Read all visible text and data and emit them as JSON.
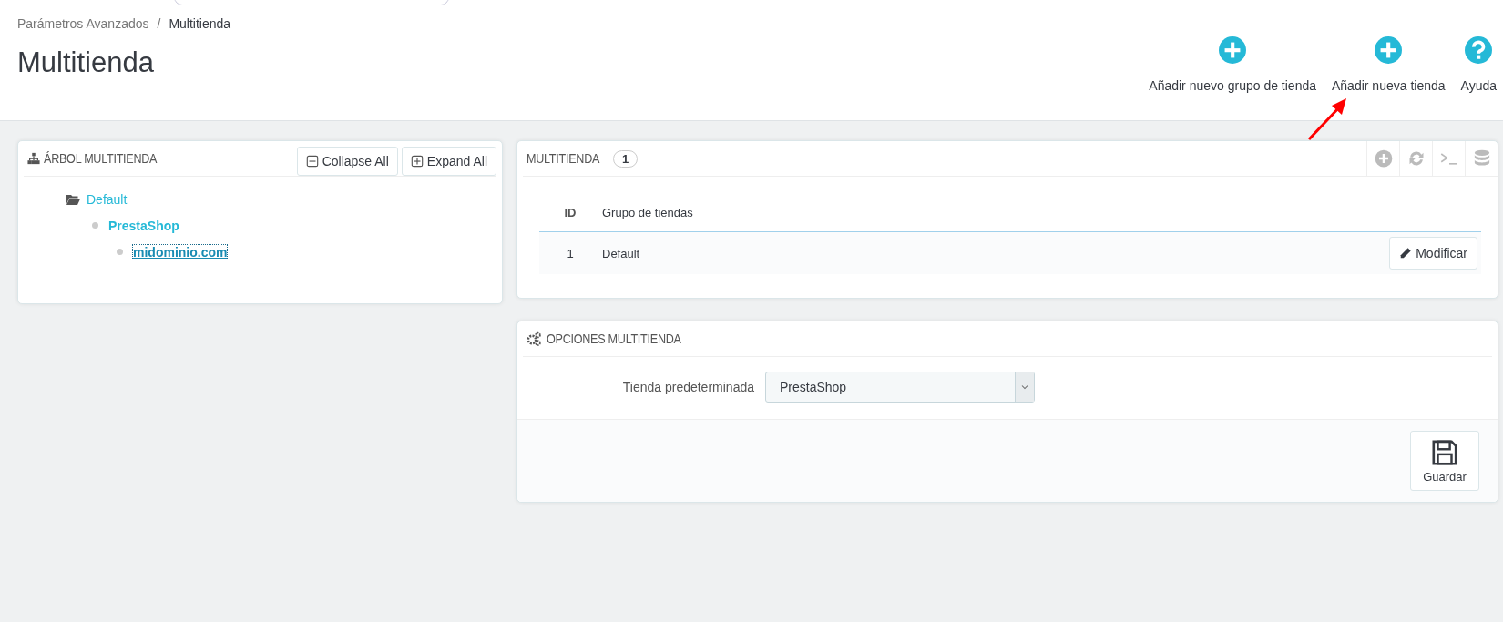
{
  "breadcrumb": [
    {
      "label": "Parámetros Avanzados",
      "current": false
    },
    {
      "label": "Multitienda",
      "current": true
    }
  ],
  "breadcrumb_separator": "/",
  "page_title": "Multitienda",
  "toolbar": [
    {
      "label": "Añadir nuevo grupo de tienda",
      "kind": "add"
    },
    {
      "label": "Añadir nueva tienda",
      "kind": "add"
    },
    {
      "label": "Ayuda",
      "kind": "help"
    }
  ],
  "tree_panel": {
    "title": "ÁRBOL MULTITIENDA",
    "buttons": [
      {
        "label": "Collapse All",
        "kind": "collapse"
      },
      {
        "label": "Expand All",
        "kind": "expand"
      }
    ],
    "tree": [
      {
        "label": "Default",
        "kind": "group",
        "focused": false,
        "children": [
          {
            "label": "PrestaShop",
            "kind": "shop",
            "focused": false,
            "children": [
              {
                "label": "midominio.com",
                "kind": "url",
                "focused": true
              }
            ]
          }
        ]
      }
    ]
  },
  "list_panel": {
    "title": "MULTITIENDA",
    "count": "1",
    "table": {
      "columns": [
        "ID",
        "Grupo de tiendas"
      ],
      "rows": [
        {
          "cells": [
            "1",
            "Default"
          ],
          "action": "Modificar"
        }
      ]
    }
  },
  "options_panel": {
    "title": "OPCIONES MULTITIENDA",
    "fields": [
      {
        "label": "Tienda predeterminada",
        "value": "PrestaShop"
      }
    ],
    "save_button": "Guardar"
  }
}
